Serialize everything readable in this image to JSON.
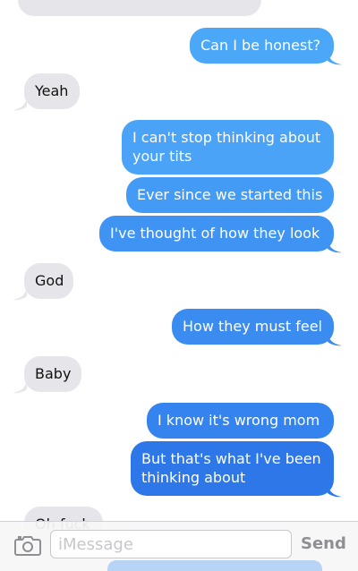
{
  "colors": {
    "incoming_bubble": "#e5e5ea",
    "outgoing_light": "#4ba7f7",
    "outgoing_dark": "#2e77e8"
  },
  "messages": [
    {
      "side": "outgoing",
      "text": "Can I be honest?"
    },
    {
      "side": "incoming",
      "text": "Yeah"
    },
    {
      "side": "outgoing",
      "text": "I can't stop thinking about your tits"
    },
    {
      "side": "outgoing",
      "text": "Ever since we started this"
    },
    {
      "side": "outgoing",
      "text": "I've thought of how they look"
    },
    {
      "side": "incoming",
      "text": "God"
    },
    {
      "side": "outgoing",
      "text": "How they must feel"
    },
    {
      "side": "incoming",
      "text": "Baby"
    },
    {
      "side": "outgoing",
      "text": "I know it's wrong mom"
    },
    {
      "side": "outgoing",
      "text": "But that's what I've been thinking about"
    },
    {
      "side": "incoming",
      "text": "Oh fuck"
    }
  ],
  "composer": {
    "camera_icon": "camera-icon",
    "placeholder": "iMessage",
    "send_label": "Send"
  }
}
